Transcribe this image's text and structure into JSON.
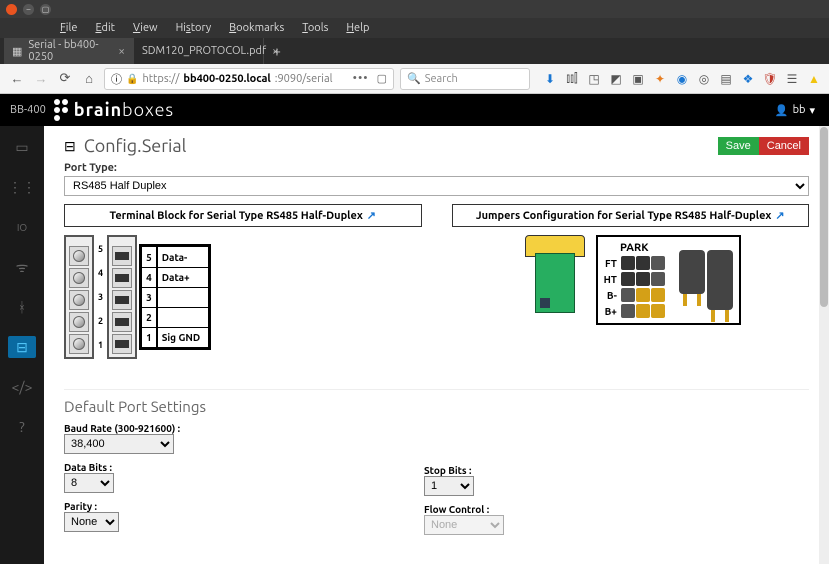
{
  "menubar": [
    "File",
    "Edit",
    "View",
    "History",
    "Bookmarks",
    "Tools",
    "Help"
  ],
  "tabs": [
    {
      "title": "Serial - bb400-0250",
      "active": true
    },
    {
      "title": "SDM120_PROTOCOL.pdf",
      "active": false
    }
  ],
  "url": {
    "scheme": "https://",
    "host": "bb400-0250.local",
    "port_path": ":9090/serial",
    "search_placeholder": "Search"
  },
  "device_tag": "BB-400",
  "brand": {
    "bold": "brain",
    "light": "boxes"
  },
  "user": "bb",
  "sidebar_icons": [
    "dashboard",
    "nodes",
    "io",
    "wifi",
    "bluetooth",
    "serial",
    "code",
    "help"
  ],
  "sidebar_active": "serial",
  "page": {
    "title": "Config.Serial",
    "save": "Save",
    "cancel": "Cancel"
  },
  "port_type": {
    "label": "Port Type:",
    "value": "RS485 Half Duplex"
  },
  "diagrams": {
    "terminal_title": "Terminal Block for Serial Type RS485 Half-Duplex",
    "jumper_title": "Jumpers Configuration for Serial Type RS485 Half-Duplex",
    "pins": [
      {
        "n": "1",
        "sig": "Sig GND"
      },
      {
        "n": "2",
        "sig": ""
      },
      {
        "n": "3",
        "sig": ""
      },
      {
        "n": "4",
        "sig": "Data+"
      },
      {
        "n": "5",
        "sig": "Data-"
      }
    ],
    "park": "PARK",
    "jumper_rows": [
      "FT",
      "HT",
      "B-",
      "B+"
    ]
  },
  "settings": {
    "title": "Default Port Settings",
    "baud": {
      "label": "Baud Rate (300-921600) :",
      "value": "38,400"
    },
    "databits": {
      "label": "Data Bits :",
      "value": "8"
    },
    "parity": {
      "label": "Parity :",
      "value": "None"
    },
    "stopbits": {
      "label": "Stop Bits :",
      "value": "1"
    },
    "flow": {
      "label": "Flow Control :",
      "value": "None"
    }
  }
}
